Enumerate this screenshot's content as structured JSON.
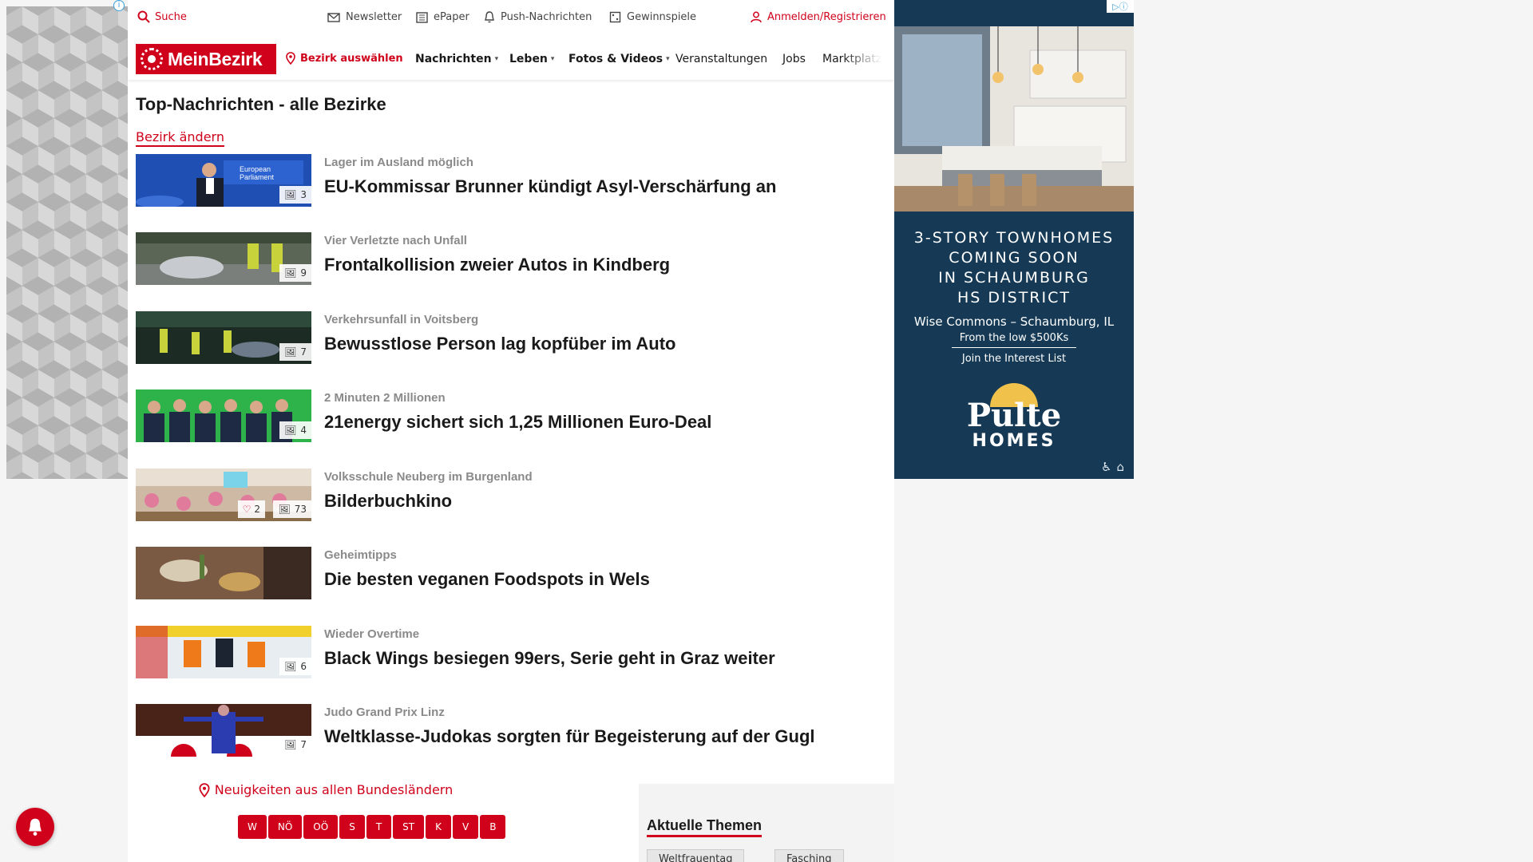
{
  "topbar": {
    "search": "Suche",
    "newsletter": "Newsletter",
    "epaper": "ePaper",
    "push": "Push-Nachrichten",
    "gewinnspiele": "Gewinnspiele",
    "login": "Anmelden/Registrieren"
  },
  "nav": {
    "logo": "MeinBezirk",
    "bezirk": "Bezirk auswählen",
    "items": [
      "Nachrichten",
      "Leben",
      "Fotos & Videos",
      "Veranstaltungen",
      "Jobs",
      "Marktplatz"
    ]
  },
  "page": {
    "title": "Top-Nachrichten - alle Bezirke",
    "change_link": "Bezirk ändern"
  },
  "articles": [
    {
      "kicker": "Lager im Ausland möglich",
      "headline": "EU-Kommissar Brunner kündigt Asyl-Verschärfung an",
      "photos": "3"
    },
    {
      "kicker": "Vier Verletzte nach Unfall",
      "headline": "Frontalkollision zweier Autos in Kindberg",
      "photos": "9"
    },
    {
      "kicker": "Verkehrsunfall in Voitsberg",
      "headline": "Bewusstlose Person lag kopfüber im Auto",
      "photos": "7"
    },
    {
      "kicker": "2 Minuten 2 Millionen",
      "headline": "21energy sichert sich 1,25 Millionen Euro-Deal",
      "photos": "4"
    },
    {
      "kicker": "Volksschule Neuberg im Burgenland",
      "headline": "Bilderbuchkino",
      "photos": "73",
      "likes": "2"
    },
    {
      "kicker": "Geheimtipps",
      "headline": "Die besten veganen Foodspots in Wels",
      "photos": ""
    },
    {
      "kicker": "Wieder Overtime",
      "headline": "Black Wings besiegen 99ers, Serie geht in Graz weiter",
      "photos": "6"
    },
    {
      "kicker": "Judo Grand Prix Linz",
      "headline": "Weltklasse-Judokas sorgten für Begeisterung auf der Gugl",
      "photos": "7"
    }
  ],
  "regions": {
    "link": "Neuigkeiten aus allen Bundesländern",
    "states": [
      "W",
      "NÖ",
      "OÖ",
      "S",
      "T",
      "ST",
      "K",
      "V",
      "B"
    ]
  },
  "topics": {
    "title": "Aktuelle Themen",
    "chips": [
      "Weltfrauentag",
      "Fasching"
    ]
  },
  "ad": {
    "headline_lines": [
      "3-STORY TOWNHOMES",
      "COMING SOON",
      "IN SCHAUMBURG",
      "HS DISTRICT"
    ],
    "location": "Wise Commons – Schaumburg, IL",
    "price": "From the low $500Ks",
    "cta": "Join the Interest List",
    "brand": "Pulte",
    "brand_sub": "HOMES"
  },
  "colors": {
    "brand_red": "#d0021b",
    "ad_navy": "#163a55"
  }
}
